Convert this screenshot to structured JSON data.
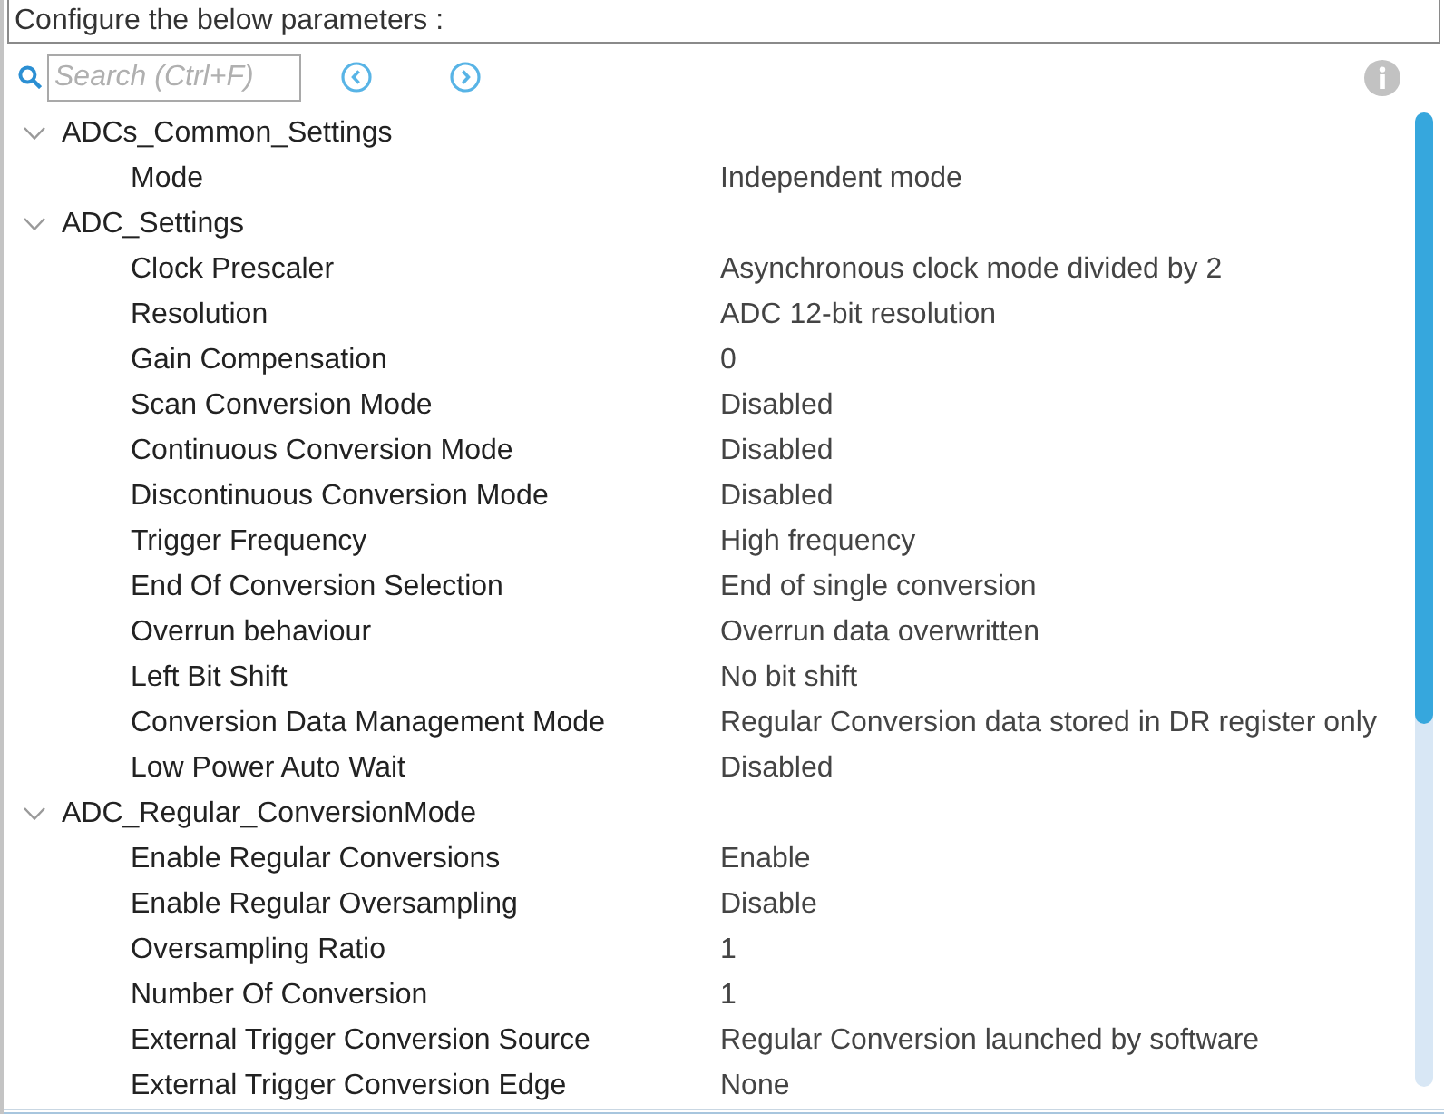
{
  "header": {
    "text": "Configure the below parameters :"
  },
  "search": {
    "placeholder": "Search (Ctrl+F)"
  },
  "groups": [
    {
      "label": "ADCs_Common_Settings",
      "expanded": true,
      "children": [
        {
          "label": "Mode",
          "value": "Independent mode"
        }
      ]
    },
    {
      "label": "ADC_Settings",
      "expanded": true,
      "children": [
        {
          "label": "Clock Prescaler",
          "value": "Asynchronous clock mode divided by 2"
        },
        {
          "label": "Resolution",
          "value": "ADC 12-bit resolution"
        },
        {
          "label": "Gain Compensation",
          "value": "0"
        },
        {
          "label": "Scan Conversion Mode",
          "value": "Disabled"
        },
        {
          "label": "Continuous Conversion Mode",
          "value": "Disabled"
        },
        {
          "label": "Discontinuous Conversion Mode",
          "value": "Disabled"
        },
        {
          "label": "Trigger Frequency",
          "value": "High frequency"
        },
        {
          "label": "End Of Conversion Selection",
          "value": "End of single conversion"
        },
        {
          "label": "Overrun behaviour",
          "value": "Overrun data overwritten"
        },
        {
          "label": "Left Bit Shift",
          "value": "No bit shift"
        },
        {
          "label": "Conversion Data Management Mode",
          "value": "Regular Conversion data stored in DR register only"
        },
        {
          "label": "Low Power Auto Wait",
          "value": "Disabled"
        }
      ]
    },
    {
      "label": "ADC_Regular_ConversionMode",
      "expanded": true,
      "children": [
        {
          "label": "Enable Regular Conversions",
          "value": "Enable"
        },
        {
          "label": "Enable Regular Oversampling",
          "value": "Disable"
        },
        {
          "label": "Oversampling Ratio",
          "value": "1"
        },
        {
          "label": "Number Of Conversion",
          "value": "1"
        },
        {
          "label": "External Trigger Conversion Source",
          "value": "Regular Conversion launched by software"
        },
        {
          "label": "External Trigger Conversion Edge",
          "value": "None"
        }
      ]
    }
  ]
}
